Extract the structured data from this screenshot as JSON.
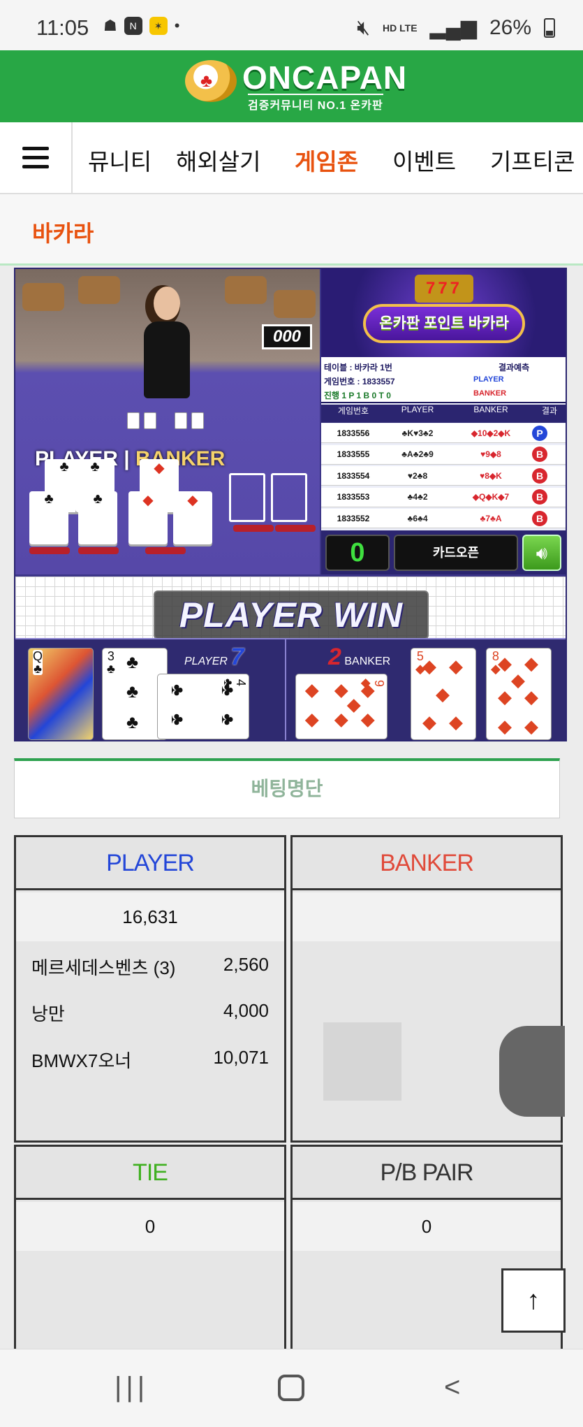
{
  "status_bar": {
    "time": "11:05",
    "network": "HD LTE",
    "battery": "26%"
  },
  "header": {
    "brand": "ONCAPAN",
    "tagline": "검증커뮤니티 NO.1 온카판"
  },
  "nav": {
    "items": [
      "뮤니티",
      "해외살기",
      "게임존",
      "이벤트",
      "기프티콘"
    ],
    "active": "게임존"
  },
  "page": {
    "title": "바카라"
  },
  "game": {
    "banner_title": "온카판 포인트 바카라",
    "slot": "777",
    "table_label": "테이블 : 바카라 1번",
    "game_number": "게임번호 : 1833557",
    "progress": "진행 1  P 1  B 0  T 0",
    "prediction_label": "결과예측",
    "pred_player": "PLAYER",
    "pred_banker": "BANKER",
    "history_headers": [
      "게임번호",
      "PLAYER",
      "BANKER",
      "결과"
    ],
    "history": [
      {
        "no": "1833556",
        "player": "♣K♥3♣2",
        "banker": "◆10◆2◆K",
        "result": "P"
      },
      {
        "no": "1833555",
        "player": "♣A♣2♣9",
        "banker": "♥9◆8",
        "result": "B"
      },
      {
        "no": "1833554",
        "player": "♥2♣8",
        "banker": "♥8◆K",
        "result": "B"
      },
      {
        "no": "1833553",
        "player": "♣4♣2",
        "banker": "◆Q◆K◆7",
        "result": "B"
      },
      {
        "no": "1833552",
        "player": "♣6♣4",
        "banker": "♣7♣A",
        "result": "B"
      }
    ],
    "count": "0",
    "card_open": "카드오픈",
    "timer": "000",
    "video_player": "PLAYER",
    "video_banker": "BANKER",
    "win_text": "PLAYER WIN",
    "player_label": "PLAYER",
    "player_score": "7",
    "banker_label": "BANKER",
    "banker_score": "2",
    "player_cards": [
      {
        "rank": "Q",
        "suit": "♣"
      },
      {
        "rank": "3",
        "suit": "♣"
      },
      {
        "rank": "4",
        "suit": "♣"
      }
    ],
    "banker_cards": [
      {
        "rank": "9",
        "suit": "◆"
      },
      {
        "rank": "5",
        "suit": "◆"
      },
      {
        "rank": "8",
        "suit": "◆"
      }
    ]
  },
  "betting": {
    "title": "베팅명단",
    "player": {
      "label": "PLAYER",
      "total": "16,631",
      "entries": [
        {
          "name": "메르세데스벤츠 (3)",
          "amount": "2,560"
        },
        {
          "name": "낭만",
          "amount": "4,000"
        },
        {
          "name": "BMWX7오너",
          "amount": "10,071"
        }
      ]
    },
    "banker": {
      "label": "BANKER",
      "total": ""
    },
    "tie": {
      "label": "TIE",
      "total": "0"
    },
    "pair": {
      "label": "P/B PAIR",
      "total": "0"
    }
  },
  "colors": {
    "accent": "#28a745",
    "active_nav": "#e8520f",
    "player": "#2346d8",
    "banker": "#e04a3a",
    "tie": "#3fb020"
  }
}
